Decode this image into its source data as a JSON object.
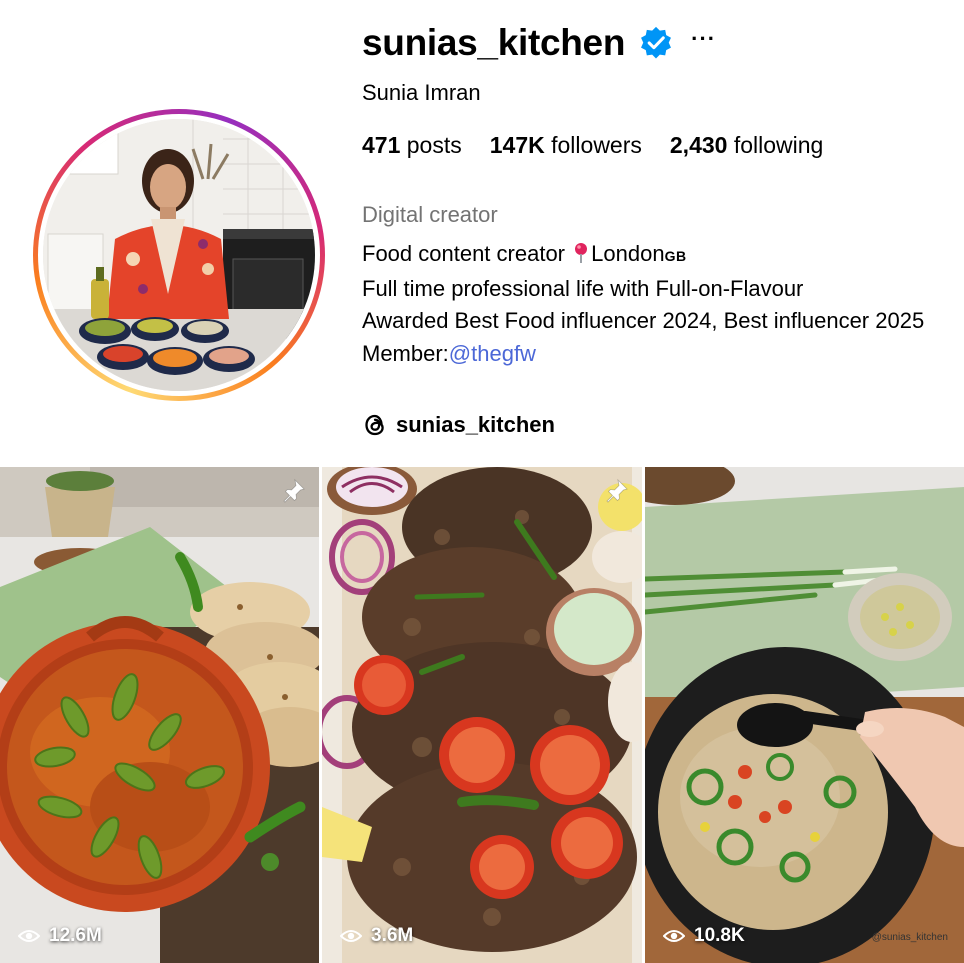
{
  "profile": {
    "username": "sunias_kitchen",
    "full_name": "Sunia Imran",
    "verified": true,
    "more_icon": "more-horizontal-icon",
    "stats": {
      "posts_count": "471",
      "posts_label": "posts",
      "followers_count": "147K",
      "followers_label": "followers",
      "following_count": "2,430",
      "following_label": "following"
    },
    "category": "Digital creator",
    "bio": {
      "line1_text": "Food content creator",
      "line1_location": "London",
      "line1_country": "GB",
      "line2": "Full time professional life with Full-on-Flavour",
      "line3": "Awarded Best Food influencer 2024, Best influencer 2025",
      "member_label": "Member:",
      "member_handle": "@thegfw"
    },
    "threads_handle": "sunias_kitchen"
  },
  "colors": {
    "verified_blue": "#0095f6",
    "link_blue": "#4c68d7",
    "secondary_text": "#737373"
  },
  "posts": [
    {
      "views": "12.6M",
      "pinned": true,
      "watermark": ""
    },
    {
      "views": "3.6M",
      "pinned": true,
      "watermark": ""
    },
    {
      "views": "10.8K",
      "pinned": false,
      "watermark": "@sunias_kitchen"
    }
  ]
}
